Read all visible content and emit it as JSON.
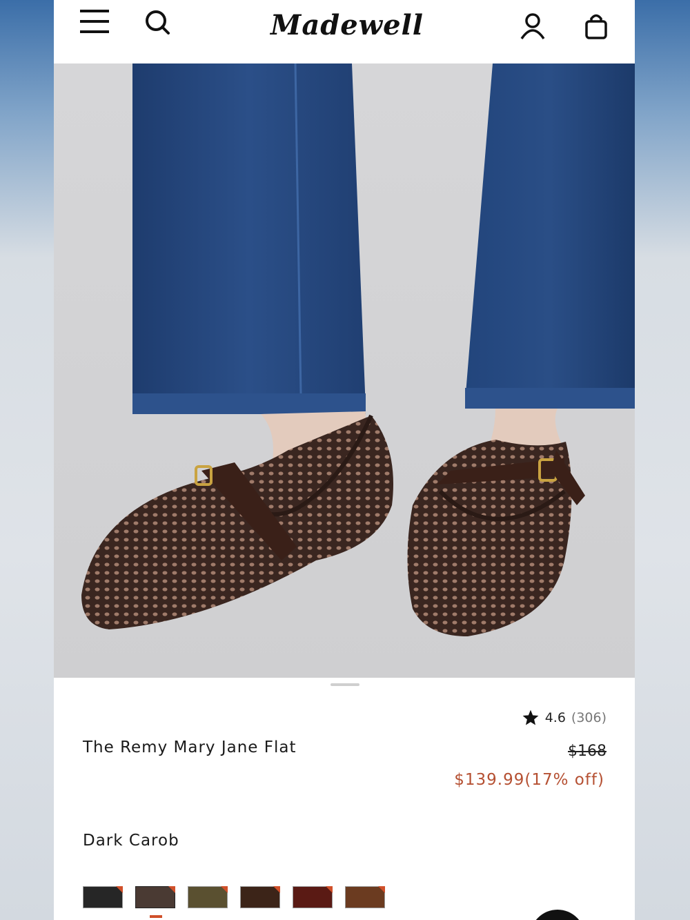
{
  "header": {
    "brand": "Madewell",
    "icons": [
      "menu-icon",
      "search-icon",
      "account-icon",
      "bag-icon"
    ]
  },
  "product": {
    "title": "The Remy Mary Jane Flat",
    "rating": "4.6",
    "review_count": "(306)",
    "original_price": "$168",
    "sale_price": "$139.99(17% off)",
    "color_name": "Dark Carob",
    "image_alt": "Woven brown Mary Jane flats worn with dark blue jeans"
  },
  "swatches": [
    {
      "color": "#262626",
      "selected": false
    },
    {
      "color": "#4a3a33",
      "selected": true
    },
    {
      "color": "#5a5030",
      "selected": false
    },
    {
      "color": "#3c2418",
      "selected": false
    },
    {
      "color": "#5a1a14",
      "selected": false
    },
    {
      "color": "#6b3b20",
      "selected": false
    }
  ],
  "colors": {
    "accent": "#b55032",
    "swatch_marker": "#d0502a"
  }
}
